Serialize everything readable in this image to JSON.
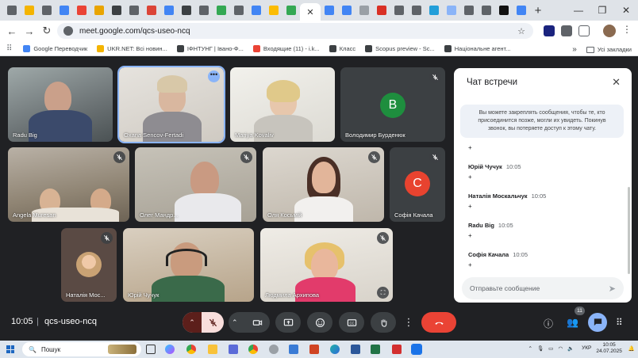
{
  "browser": {
    "tabs": [
      {
        "icon": "chrome-icon",
        "color": "#5f6368"
      },
      {
        "icon": "ukr-net-icon",
        "color": "#f4b400"
      },
      {
        "icon": "chrome-icon",
        "color": "#5f6368"
      },
      {
        "icon": "doc-icon",
        "color": "#4285f4"
      },
      {
        "icon": "gmail-icon",
        "color": "#ea4335"
      },
      {
        "icon": "lamp-icon",
        "color": "#e9a400"
      },
      {
        "icon": "circle-icon",
        "color": "#3c4043"
      },
      {
        "icon": "chrome-icon",
        "color": "#5f6368"
      },
      {
        "icon": "grid-icon",
        "color": "#db4437"
      },
      {
        "icon": "gemini-icon",
        "color": "#4285f4"
      },
      {
        "icon": "circle-icon",
        "color": "#3c4043"
      },
      {
        "icon": "chrome-icon",
        "color": "#5f6368"
      },
      {
        "icon": "maps-icon",
        "color": "#34a853"
      },
      {
        "icon": "chrome-icon",
        "color": "#5f6368"
      },
      {
        "icon": "google-icon",
        "color": "#4285f4"
      },
      {
        "icon": "star-icon",
        "color": "#fbbc04"
      },
      {
        "icon": "classroom-icon",
        "color": "#34a853"
      }
    ],
    "tabs_right": [
      {
        "icon": "doc-icon",
        "color": "#4285f4"
      },
      {
        "icon": "doc-icon",
        "color": "#4285f4"
      },
      {
        "icon": "feather-icon",
        "color": "#9aa0a6"
      },
      {
        "icon": "pdf-icon",
        "color": "#d93025"
      },
      {
        "icon": "chrome-icon",
        "color": "#5f6368"
      },
      {
        "icon": "chrome-icon",
        "color": "#5f6368"
      },
      {
        "icon": "telegram-icon",
        "color": "#229ed9"
      },
      {
        "icon": "cloud-icon",
        "color": "#8ab4f8"
      },
      {
        "icon": "chrome-icon",
        "color": "#5f6368"
      },
      {
        "icon": "chrome-icon",
        "color": "#5f6368"
      },
      {
        "icon": "tiktok-icon",
        "color": "#111111"
      },
      {
        "icon": "translate-icon",
        "color": "#4285f4"
      }
    ],
    "url": "meet.google.com/qcs-useo-ncq"
  },
  "bookmarks": [
    {
      "label": "Google Переводчик",
      "color": "#4285f4"
    },
    {
      "label": "UKR.NET: Всі новин...",
      "color": "#f4b400"
    },
    {
      "label": "ІФНТУНГ | Івано-Ф...",
      "color": "#3c4043"
    },
    {
      "label": "Входящие (11) - i.k...",
      "color": "#ea4335"
    },
    {
      "label": "Класс",
      "color": "#3c4043"
    },
    {
      "label": "Scopus preview - Sc...",
      "color": "#3c4043"
    },
    {
      "label": "Національне агент...",
      "color": "#3c4043"
    }
  ],
  "bookmarks_all": "Усі закладки",
  "participants": {
    "radu_big": "Radu Big",
    "oxana": "Oxana Sencov-Fertadi",
    "mariya": "Mariya Kovaliv",
    "volodymyr": "Володимир Бурденюк",
    "volodymyr_letter": "В",
    "angela": "Angela Muresan",
    "oleg": "Олег Мандр...",
    "olya": "Оля Косьмій",
    "sofia": "Софія Качала",
    "sofia_letter": "С",
    "natalia": "Наталія Мос...",
    "yuriy": "Юрій Чучук",
    "lyudmyla": "Людмила Архипова"
  },
  "chat": {
    "title": "Чат встречи",
    "note": "Вы можете закреплять сообщения, чтобы те, кто присоединится позже, могли их увидеть. Покинув звонок, вы потеряете доступ к этому чату.",
    "messages": [
      {
        "who": "",
        "time": "",
        "body": "+"
      },
      {
        "who": "Юрій Чучук",
        "time": "10:05",
        "body": "+"
      },
      {
        "who": "Наталія Москальчук",
        "time": "10:05",
        "body": "+"
      },
      {
        "who": "Radu Big",
        "time": "10:05",
        "body": "+"
      },
      {
        "who": "Софія Качала",
        "time": "10:05",
        "body": "+"
      }
    ],
    "placeholder": "Отправьте сообщение"
  },
  "meeting": {
    "time": "10:05",
    "separator": "|",
    "code": "qcs-useo-ncq",
    "participant_count": "11"
  },
  "taskbar": {
    "search_placeholder": "Пошук",
    "lang": "УКР",
    "time": "10:05",
    "date": "24.07.2025"
  },
  "colors": {
    "meet_bg": "#202124",
    "hangup": "#ea4335",
    "chat_active": "#8ab4f8",
    "volodymyr_avatar": "#1e8e3e",
    "sofia_avatar": "#e8432f"
  }
}
